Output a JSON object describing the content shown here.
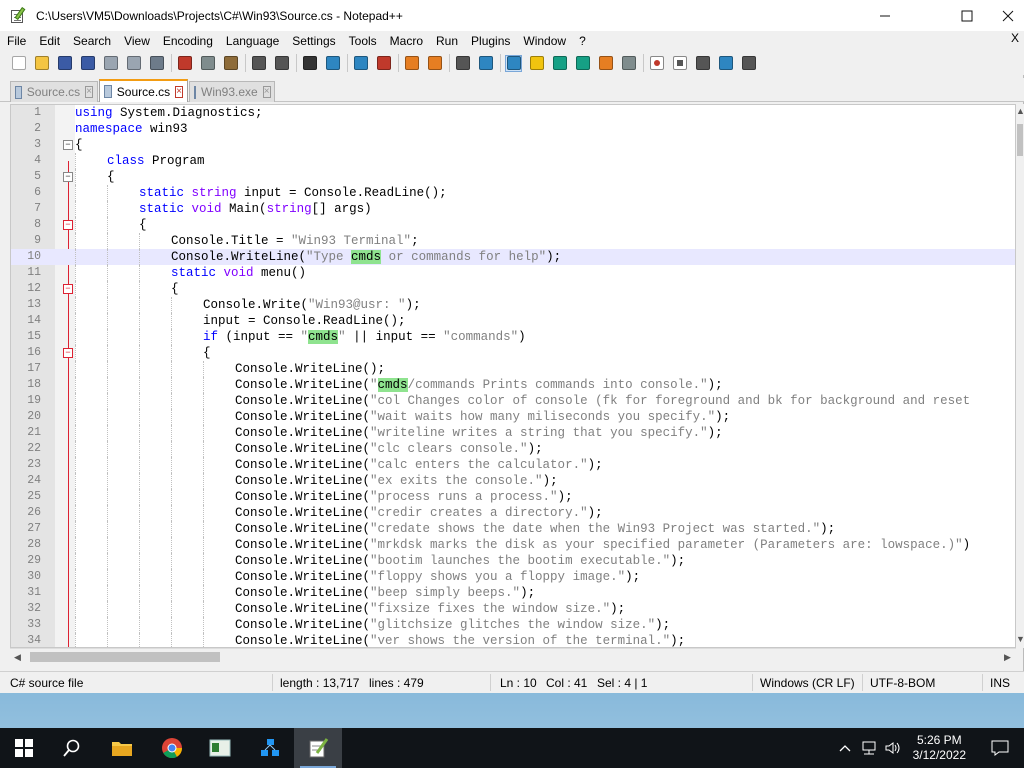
{
  "window": {
    "title": "C:\\Users\\VM5\\Downloads\\Projects\\C#\\Win93\\Source.cs - Notepad++",
    "minimize_icon": "minimize-icon",
    "maximize_icon": "maximize-icon",
    "close_icon": "close-icon"
  },
  "menu": [
    "File",
    "Edit",
    "Search",
    "View",
    "Encoding",
    "Language",
    "Settings",
    "Tools",
    "Macro",
    "Run",
    "Plugins",
    "Window",
    "?"
  ],
  "menu_close": "X",
  "toolbar_icons": [
    "new-file-icon",
    "open-file-icon",
    "save-icon",
    "save-all-icon",
    "close-icon",
    "close-all-icon",
    "print-icon",
    "cut-icon",
    "copy-icon",
    "paste-icon",
    "undo-icon",
    "redo-icon",
    "find-icon",
    "replace-icon",
    "zoom-in-icon",
    "zoom-out-icon",
    "sync-v-icon",
    "sync-h-icon",
    "word-wrap-icon",
    "show-all-chars-icon",
    "indent-guide-icon",
    "udl-icon",
    "doc-map-icon",
    "function-list-icon",
    "folder-workspace-icon",
    "monitor-icon",
    "record-macro-icon",
    "stop-macro-icon",
    "play-macro-icon",
    "run-macro-multiple-icon",
    "save-macro-icon"
  ],
  "tabs": [
    {
      "label": "Source.cs",
      "active": false
    },
    {
      "label": "Source.cs",
      "active": true
    },
    {
      "label": "Win93.exe",
      "active": false
    }
  ],
  "code": [
    {
      "n": "1",
      "indent": 0,
      "fold": "",
      "html": [
        [
          "kw",
          "using"
        ],
        [
          "",
          " System.Diagnostics;"
        ]
      ]
    },
    {
      "n": "2",
      "indent": 0,
      "fold": "",
      "html": [
        [
          "kw",
          "namespace"
        ],
        [
          "",
          " win93"
        ]
      ]
    },
    {
      "n": "3",
      "indent": 0,
      "fold": "box",
      "html": [
        [
          "",
          "{"
        ]
      ]
    },
    {
      "n": "4",
      "indent": 1,
      "fold": "",
      "html": [
        [
          "kw",
          "class"
        ],
        [
          "",
          " Program"
        ]
      ]
    },
    {
      "n": "5",
      "indent": 1,
      "fold": "box",
      "html": [
        [
          "",
          "{"
        ]
      ]
    },
    {
      "n": "6",
      "indent": 2,
      "fold": "",
      "html": [
        [
          "kw",
          "static"
        ],
        [
          "",
          " "
        ],
        [
          "ty",
          "string"
        ],
        [
          "",
          " input = Console.ReadLine();"
        ]
      ]
    },
    {
      "n": "7",
      "indent": 2,
      "fold": "",
      "html": [
        [
          "kw",
          "static"
        ],
        [
          "",
          " "
        ],
        [
          "ty",
          "void"
        ],
        [
          "",
          " Main("
        ],
        [
          "ty",
          "string"
        ],
        [
          "",
          "[] args)"
        ]
      ]
    },
    {
      "n": "8",
      "indent": 2,
      "fold": "redbox",
      "html": [
        [
          "",
          "{"
        ]
      ]
    },
    {
      "n": "9",
      "indent": 3,
      "fold": "",
      "html": [
        [
          "",
          "Console.Title = "
        ],
        [
          "str",
          "\"Win93 Terminal\""
        ],
        [
          "",
          ";"
        ]
      ]
    },
    {
      "n": "10",
      "indent": 3,
      "fold": "",
      "current": true,
      "html": [
        [
          "",
          "Console.WriteLine("
        ],
        [
          "str",
          "\"Type "
        ],
        [
          "hl",
          "cmds"
        ],
        [
          "str",
          " or commands for help\""
        ],
        [
          "",
          ");"
        ]
      ]
    },
    {
      "n": "11",
      "indent": 3,
      "fold": "",
      "html": [
        [
          "kw",
          "static"
        ],
        [
          "",
          " "
        ],
        [
          "ty",
          "void"
        ],
        [
          "",
          " menu()"
        ]
      ]
    },
    {
      "n": "12",
      "indent": 3,
      "fold": "redbox",
      "html": [
        [
          "",
          "{"
        ]
      ]
    },
    {
      "n": "13",
      "indent": 4,
      "fold": "",
      "html": [
        [
          "",
          "Console.Write("
        ],
        [
          "str",
          "\"Win93@usr: \""
        ],
        [
          "",
          ");"
        ]
      ]
    },
    {
      "n": "14",
      "indent": 4,
      "fold": "",
      "html": [
        [
          "",
          "input = Console.ReadLine();"
        ]
      ]
    },
    {
      "n": "15",
      "indent": 4,
      "fold": "",
      "html": [
        [
          "kw",
          "if"
        ],
        [
          "",
          " (input == "
        ],
        [
          "str",
          "\""
        ],
        [
          "hl",
          "cmds"
        ],
        [
          "str",
          "\""
        ],
        [
          "",
          " || input == "
        ],
        [
          "str",
          "\"commands\""
        ],
        [
          "",
          ")"
        ]
      ]
    },
    {
      "n": "16",
      "indent": 4,
      "fold": "redbox",
      "html": [
        [
          "",
          "{"
        ]
      ]
    },
    {
      "n": "17",
      "indent": 5,
      "fold": "",
      "html": [
        [
          "",
          "Console.WriteLine();"
        ]
      ]
    },
    {
      "n": "18",
      "indent": 5,
      "fold": "",
      "html": [
        [
          "",
          "Console.WriteLine("
        ],
        [
          "str",
          "\""
        ],
        [
          "hl",
          "cmds"
        ],
        [
          "str",
          "/commands Prints commands into console.\""
        ],
        [
          "",
          ");"
        ]
      ]
    },
    {
      "n": "19",
      "indent": 5,
      "fold": "",
      "html": [
        [
          "",
          "Console.WriteLine("
        ],
        [
          "str",
          "\"col Changes color of console (fk for foreground and bk for background and reset"
        ]
      ]
    },
    {
      "n": "20",
      "indent": 5,
      "fold": "",
      "html": [
        [
          "",
          "Console.WriteLine("
        ],
        [
          "str",
          "\"wait waits how many miliseconds you specify.\""
        ],
        [
          "",
          ");"
        ]
      ]
    },
    {
      "n": "21",
      "indent": 5,
      "fold": "",
      "html": [
        [
          "",
          "Console.WriteLine("
        ],
        [
          "str",
          "\"writeline writes a string that you specify.\""
        ],
        [
          "",
          ");"
        ]
      ]
    },
    {
      "n": "22",
      "indent": 5,
      "fold": "",
      "html": [
        [
          "",
          "Console.WriteLine("
        ],
        [
          "str",
          "\"clc clears console.\""
        ],
        [
          "",
          ");"
        ]
      ]
    },
    {
      "n": "23",
      "indent": 5,
      "fold": "",
      "html": [
        [
          "",
          "Console.WriteLine("
        ],
        [
          "str",
          "\"calc enters the calculator.\""
        ],
        [
          "",
          ");"
        ]
      ]
    },
    {
      "n": "24",
      "indent": 5,
      "fold": "",
      "html": [
        [
          "",
          "Console.WriteLine("
        ],
        [
          "str",
          "\"ex exits the console.\""
        ],
        [
          "",
          ");"
        ]
      ]
    },
    {
      "n": "25",
      "indent": 5,
      "fold": "",
      "html": [
        [
          "",
          "Console.WriteLine("
        ],
        [
          "str",
          "\"process runs a process.\""
        ],
        [
          "",
          ");"
        ]
      ]
    },
    {
      "n": "26",
      "indent": 5,
      "fold": "",
      "html": [
        [
          "",
          "Console.WriteLine("
        ],
        [
          "str",
          "\"credir creates a directory.\""
        ],
        [
          "",
          ");"
        ]
      ]
    },
    {
      "n": "27",
      "indent": 5,
      "fold": "",
      "html": [
        [
          "",
          "Console.WriteLine("
        ],
        [
          "str",
          "\"credate shows the date when the Win93 Project was started.\""
        ],
        [
          "",
          ");"
        ]
      ]
    },
    {
      "n": "28",
      "indent": 5,
      "fold": "",
      "html": [
        [
          "",
          "Console.WriteLine("
        ],
        [
          "str",
          "\"mrkdsk marks the disk as your specified parameter (Parameters are: lowspace.)\""
        ],
        [
          "",
          ")"
        ]
      ]
    },
    {
      "n": "29",
      "indent": 5,
      "fold": "",
      "html": [
        [
          "",
          "Console.WriteLine("
        ],
        [
          "str",
          "\"bootim launches the bootim executable.\""
        ],
        [
          "",
          ");"
        ]
      ]
    },
    {
      "n": "30",
      "indent": 5,
      "fold": "",
      "html": [
        [
          "",
          "Console.WriteLine("
        ],
        [
          "str",
          "\"floppy shows you a floppy image.\""
        ],
        [
          "",
          ");"
        ]
      ]
    },
    {
      "n": "31",
      "indent": 5,
      "fold": "",
      "html": [
        [
          "",
          "Console.WriteLine("
        ],
        [
          "str",
          "\"beep simply beeps.\""
        ],
        [
          "",
          ");"
        ]
      ]
    },
    {
      "n": "32",
      "indent": 5,
      "fold": "",
      "html": [
        [
          "",
          "Console.WriteLine("
        ],
        [
          "str",
          "\"fixsize fixes the window size.\""
        ],
        [
          "",
          ");"
        ]
      ]
    },
    {
      "n": "33",
      "indent": 5,
      "fold": "",
      "html": [
        [
          "",
          "Console.WriteLine("
        ],
        [
          "str",
          "\"glitchsize glitches the window size.\""
        ],
        [
          "",
          ");"
        ]
      ]
    },
    {
      "n": "34",
      "indent": 5,
      "fold": "",
      "html": [
        [
          "",
          "Console.WriteLine("
        ],
        [
          "str",
          "\"ver shows the version of the terminal.\""
        ],
        [
          "",
          ");"
        ]
      ]
    }
  ],
  "status": {
    "file_type": "C# source file",
    "length": "length : 13,717",
    "lines": "lines : 479",
    "ln": "Ln : 10",
    "col": "Col : 41",
    "sel": "Sel : 4 | 1",
    "eol": "Windows (CR LF)",
    "encoding": "UTF-8-BOM",
    "mode": "INS"
  },
  "taskbar": {
    "time": "5:26 PM",
    "date": "3/12/2022"
  },
  "colors": {
    "keyword": "#0000ff",
    "type": "#8000ff",
    "string": "#808080",
    "highlight": "#8fe38f",
    "current_line": "#e8e8ff",
    "active_tab_accent": "#f39c12"
  }
}
